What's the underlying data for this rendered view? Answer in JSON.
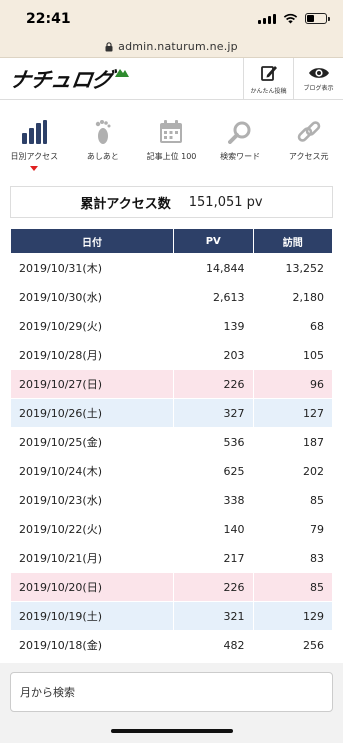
{
  "status_bar": {
    "time": "22:41"
  },
  "browser": {
    "url": "admin.naturum.ne.jp"
  },
  "header": {
    "logo_text": "ナチュログ",
    "quick_post_label": "かんたん投稿",
    "blog_view_label": "ブログ表示"
  },
  "nav": {
    "items": [
      {
        "label": "日別アクセス",
        "icon": "bar-chart-icon",
        "active": true
      },
      {
        "label": "あしあと",
        "icon": "footprint-icon",
        "active": false
      },
      {
        "label": "記事上位 100",
        "icon": "calendar-icon",
        "active": false
      },
      {
        "label": "検索ワード",
        "icon": "magnifier-icon",
        "active": false
      },
      {
        "label": "アクセス元",
        "icon": "link-icon",
        "active": false
      }
    ]
  },
  "summary": {
    "label": "累計アクセス数",
    "value": "151,051 pv"
  },
  "table": {
    "headers": [
      "日付",
      "PV",
      "訪問"
    ],
    "rows": [
      {
        "date": "2019/10/31(木)",
        "pv": "14,844",
        "visits": "13,252",
        "day": "weekday"
      },
      {
        "date": "2019/10/30(水)",
        "pv": "2,613",
        "visits": "2,180",
        "day": "weekday"
      },
      {
        "date": "2019/10/29(火)",
        "pv": "139",
        "visits": "68",
        "day": "weekday"
      },
      {
        "date": "2019/10/28(月)",
        "pv": "203",
        "visits": "105",
        "day": "weekday"
      },
      {
        "date": "2019/10/27(日)",
        "pv": "226",
        "visits": "96",
        "day": "sun"
      },
      {
        "date": "2019/10/26(土)",
        "pv": "327",
        "visits": "127",
        "day": "sat"
      },
      {
        "date": "2019/10/25(金)",
        "pv": "536",
        "visits": "187",
        "day": "weekday"
      },
      {
        "date": "2019/10/24(木)",
        "pv": "625",
        "visits": "202",
        "day": "weekday"
      },
      {
        "date": "2019/10/23(水)",
        "pv": "338",
        "visits": "85",
        "day": "weekday"
      },
      {
        "date": "2019/10/22(火)",
        "pv": "140",
        "visits": "79",
        "day": "weekday"
      },
      {
        "date": "2019/10/21(月)",
        "pv": "217",
        "visits": "83",
        "day": "weekday"
      },
      {
        "date": "2019/10/20(日)",
        "pv": "226",
        "visits": "85",
        "day": "sun"
      },
      {
        "date": "2019/10/19(土)",
        "pv": "321",
        "visits": "129",
        "day": "sat"
      },
      {
        "date": "2019/10/18(金)",
        "pv": "482",
        "visits": "256",
        "day": "weekday"
      }
    ]
  },
  "month_search": {
    "label": "月から検索"
  },
  "colors": {
    "header_bg": "#2d4068",
    "sunday_row": "#fbe4ea",
    "saturday_row": "#e6f0fa",
    "active_icon": "#2d4068",
    "inactive_icon": "#aaaaaa",
    "accent_red": "#e02020"
  }
}
